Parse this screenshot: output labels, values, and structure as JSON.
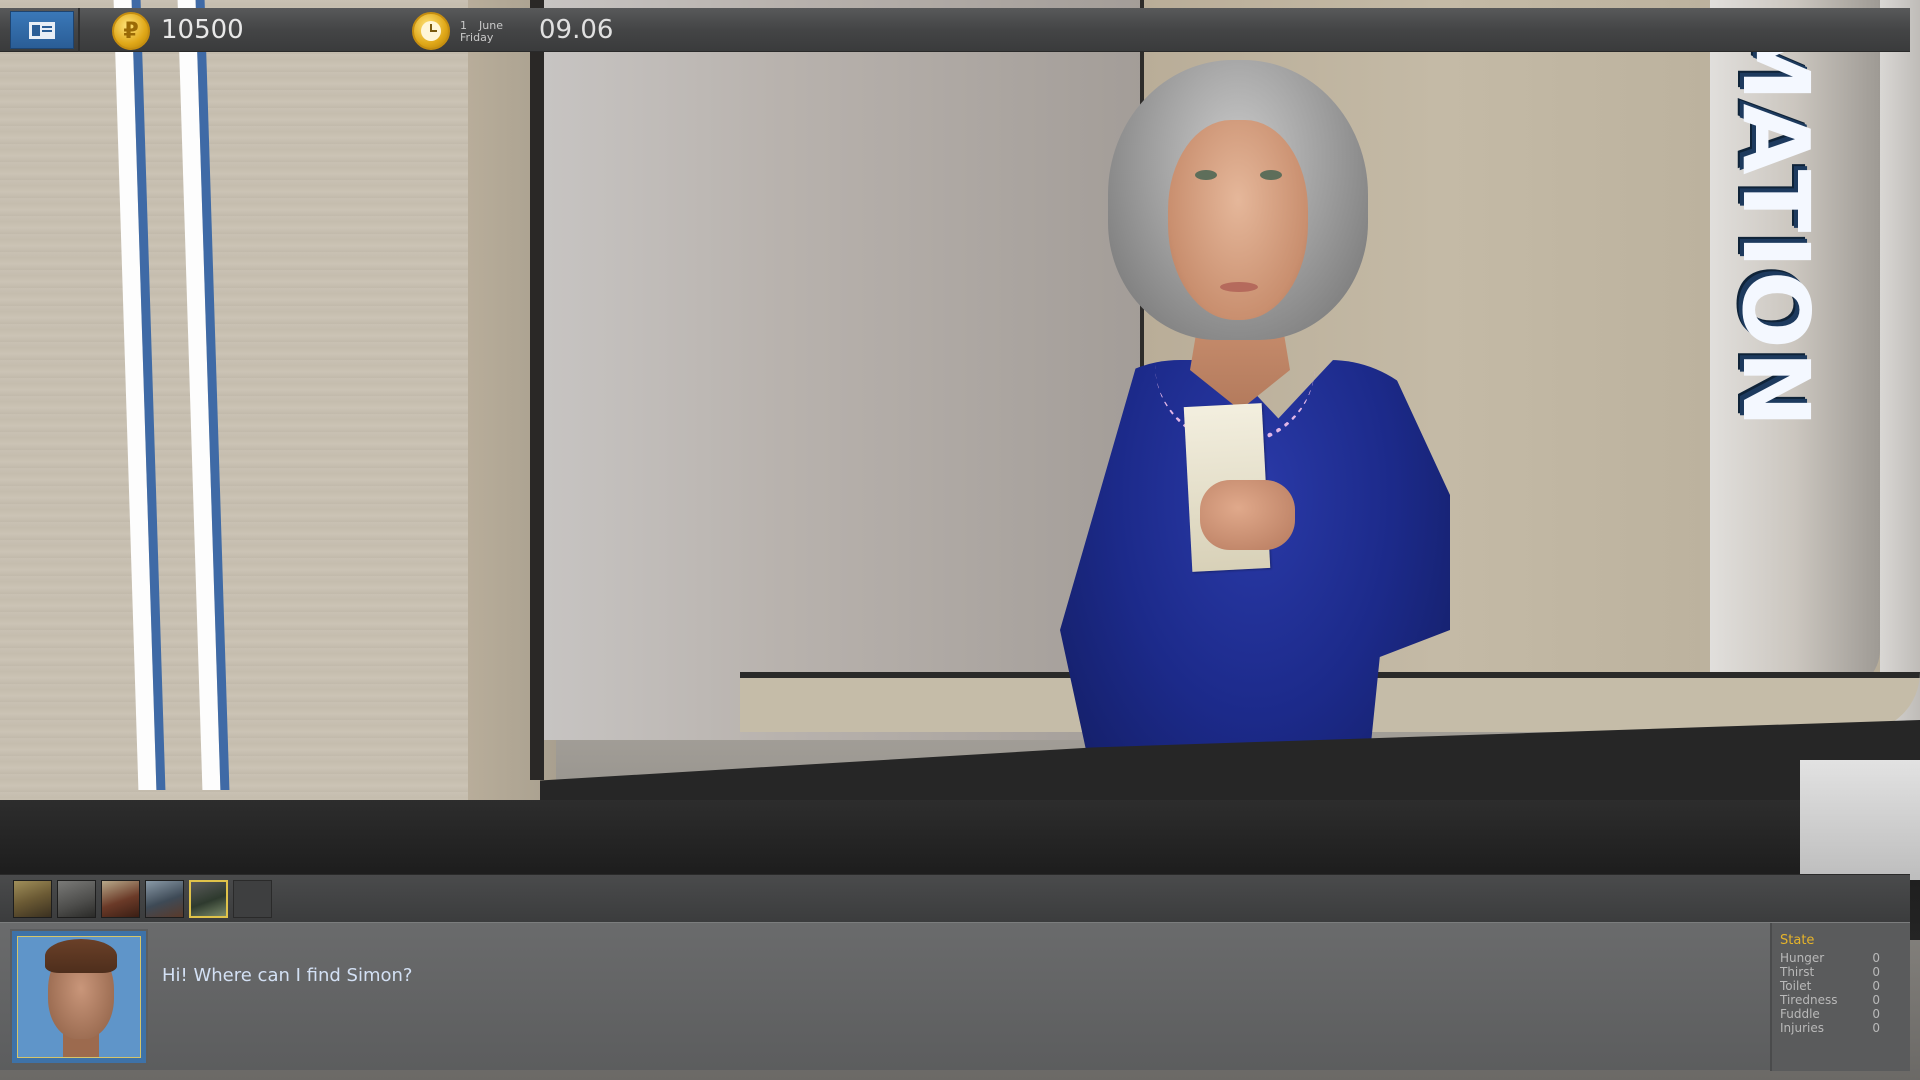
{
  "hud": {
    "money": "10500",
    "currency_symbol": "₽",
    "date_day": "1",
    "date_month": "June",
    "date_weekday": "Friday",
    "time": "09.06"
  },
  "scene": {
    "sign_text": "MATION"
  },
  "locations": [
    {
      "name": "location-1",
      "selected": false
    },
    {
      "name": "location-2",
      "selected": false
    },
    {
      "name": "location-3",
      "selected": false
    },
    {
      "name": "location-4",
      "selected": false
    },
    {
      "name": "location-5",
      "selected": true
    },
    {
      "name": "location-6-empty",
      "selected": false
    }
  ],
  "dialog": {
    "text": "Hi! Where can I find Simon?"
  },
  "state": {
    "title": "State",
    "rows": [
      {
        "label": "Hunger",
        "value": "0"
      },
      {
        "label": "Thirst",
        "value": "0"
      },
      {
        "label": "Toilet",
        "value": "0"
      },
      {
        "label": "Tiredness",
        "value": "0"
      },
      {
        "label": "Fuddle",
        "value": "0"
      },
      {
        "label": "Injuries",
        "value": "0"
      }
    ]
  },
  "colors": {
    "accent_blue": "#2a5d96",
    "gold": "#e0a818",
    "state_title": "#e5b32a",
    "dialog_text": "#d3e0f4"
  }
}
